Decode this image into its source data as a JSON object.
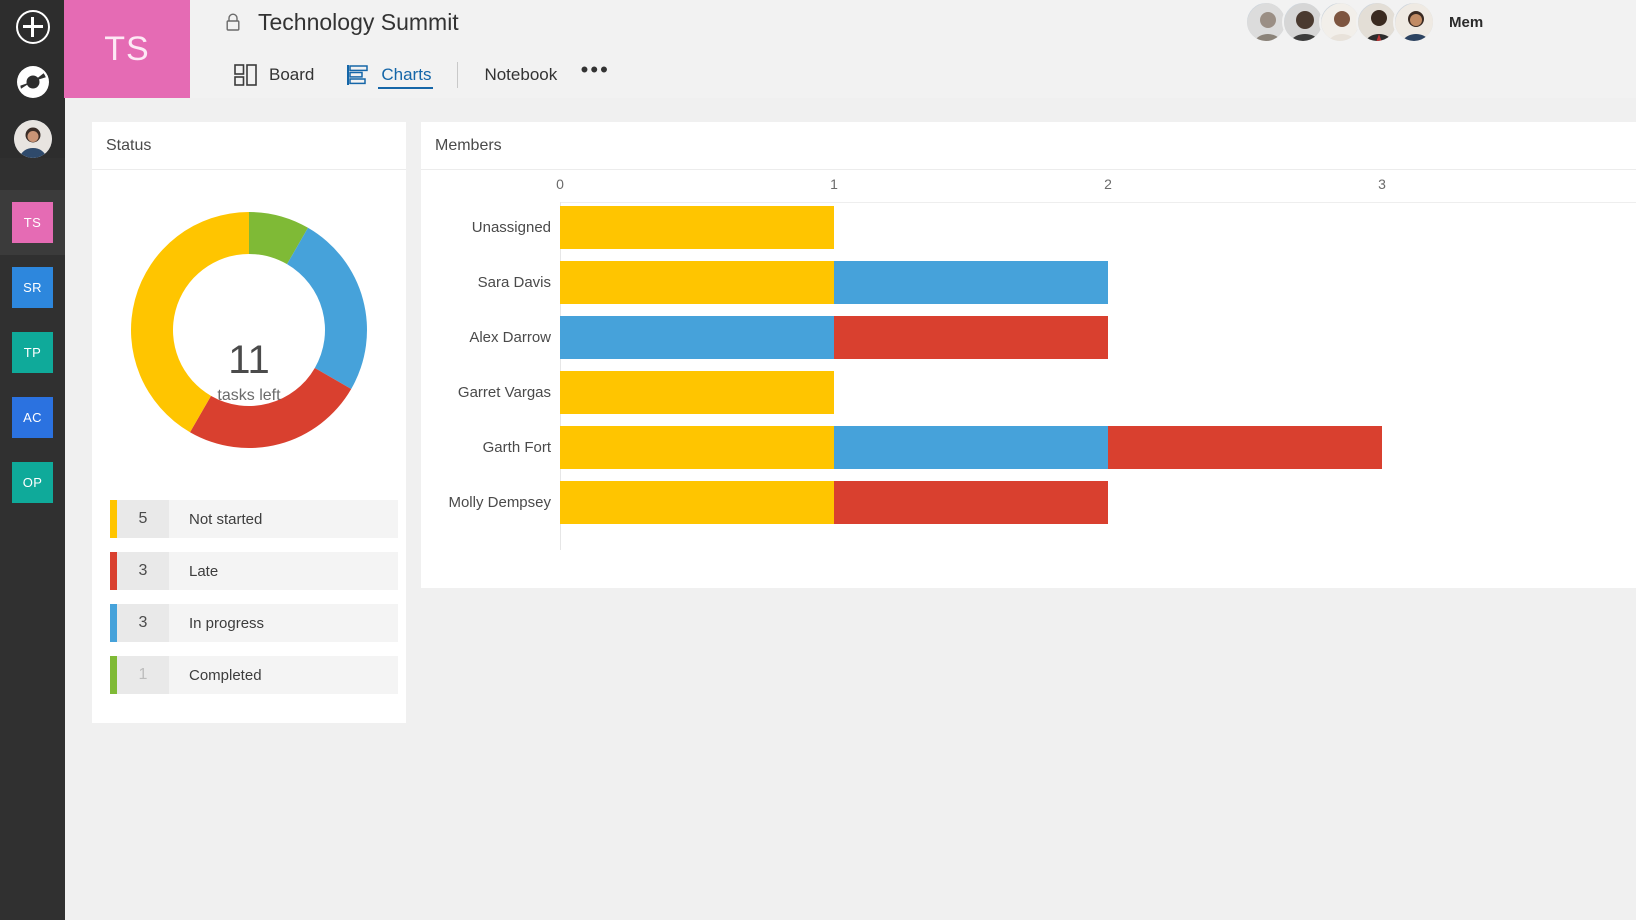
{
  "app": {
    "rail": {
      "add_label": "New",
      "add_icon": "plus-circle-icon",
      "logo_icon": "planner-donut-logo-icon",
      "avatar_label": "User avatar",
      "plans": [
        {
          "initials": "TS",
          "color": "#e56bb4",
          "selected": true
        },
        {
          "initials": "SR",
          "color": "#2d87dd",
          "selected": false
        },
        {
          "initials": "TP",
          "color": "#0faa9a",
          "selected": false
        },
        {
          "initials": "AC",
          "color": "#2b72e0",
          "selected": false
        },
        {
          "initials": "OP",
          "color": "#0faa9a",
          "selected": false
        }
      ]
    },
    "plan_tile": {
      "initials": "TS",
      "color": "#e56bb4"
    },
    "header": {
      "lock_icon": "lock-icon",
      "title": "Technology Summit",
      "members_label": "Mem",
      "avatar_count": 5
    },
    "tabs": [
      {
        "id": "board",
        "label": "Board",
        "icon": "board-grid-icon",
        "active": false
      },
      {
        "id": "charts",
        "label": "Charts",
        "icon": "charts-bar-icon",
        "active": true
      },
      {
        "id": "notebook",
        "label": "Notebook",
        "icon": "",
        "active": false
      }
    ],
    "more_menu": {
      "label": "•••",
      "icon": "ellipsis-icon"
    }
  },
  "status_card": {
    "title": "Status",
    "center_number": "11",
    "center_sublabel": "tasks left",
    "legend": [
      {
        "count": "5",
        "label": "Not started",
        "color": "#ffc500",
        "dim": false
      },
      {
        "count": "3",
        "label": "Late",
        "color": "#d9402f",
        "dim": false
      },
      {
        "count": "3",
        "label": "In progress",
        "color": "#46a2da",
        "dim": false
      },
      {
        "count": "1",
        "label": "Completed",
        "color": "#7fba36",
        "dim": true
      }
    ]
  },
  "members_card": {
    "title": "Members"
  },
  "chart_data": [
    {
      "id": "status-donut",
      "type": "pie",
      "title": "Status",
      "subtype": "donut",
      "center_label": "11",
      "center_sublabel": "tasks left",
      "start_angle_deg": 0,
      "categories": [
        "Completed",
        "In progress",
        "Late",
        "Not started"
      ],
      "values": [
        1,
        3,
        3,
        5
      ],
      "colors": [
        "#7fba36",
        "#46a2da",
        "#d9402f",
        "#ffc500"
      ],
      "total": 12,
      "legend": "below"
    },
    {
      "id": "members-bars",
      "type": "bar",
      "orientation": "horizontal",
      "stacked": true,
      "title": "Members",
      "xlabel": "",
      "ylabel": "",
      "xlim": [
        0,
        3.38
      ],
      "xticks": [
        0,
        1,
        2,
        3
      ],
      "xticklabels": [
        "0",
        "1",
        "2",
        "3"
      ],
      "grid": false,
      "categories": [
        "Unassigned",
        "Sara Davis",
        "Alex Darrow",
        "Garret Vargas",
        "Garth Fort",
        "Molly Dempsey"
      ],
      "series": [
        {
          "name": "Not started",
          "color": "#ffc500",
          "values": [
            1,
            1,
            0,
            1,
            1,
            1
          ]
        },
        {
          "name": "In progress",
          "color": "#46a2da",
          "values": [
            0,
            1,
            1,
            0,
            1,
            0
          ]
        },
        {
          "name": "Late",
          "color": "#d9402f",
          "values": [
            0,
            0,
            1,
            0,
            1,
            1
          ]
        },
        {
          "name": "Completed",
          "color": "#7fba36",
          "values": [
            0,
            0,
            0,
            0,
            0,
            0
          ]
        }
      ],
      "totals": [
        1,
        2,
        2,
        1,
        3,
        2
      ]
    }
  ],
  "colors": {
    "not_started": "#ffc500",
    "in_progress": "#46a2da",
    "late": "#d9402f",
    "completed": "#7fba36",
    "accent": "#1566a8",
    "rail": "#303030",
    "canvas": "#f0f0f0",
    "header": "#f2f2f2"
  }
}
